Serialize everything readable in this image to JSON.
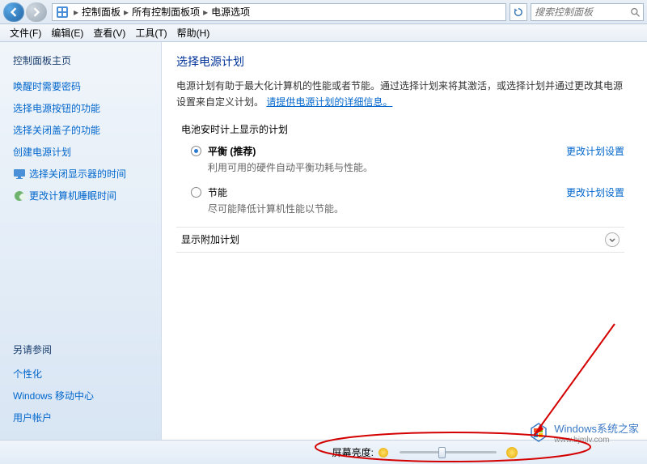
{
  "nav": {
    "breadcrumb": {
      "root_icon": "control-panel-icon",
      "parts": [
        "控制面板",
        "所有控制面板项",
        "电源选项"
      ]
    },
    "search_placeholder": "搜索控制面板"
  },
  "menu": {
    "items": [
      {
        "label": "文件(F)"
      },
      {
        "label": "编辑(E)"
      },
      {
        "label": "查看(V)"
      },
      {
        "label": "工具(T)"
      },
      {
        "label": "帮助(H)"
      }
    ]
  },
  "sidebar": {
    "home": "控制面板主页",
    "links": [
      {
        "label": "唤醒时需要密码",
        "icon": null
      },
      {
        "label": "选择电源按钮的功能",
        "icon": null
      },
      {
        "label": "选择关闭盖子的功能",
        "icon": null
      },
      {
        "label": "创建电源计划",
        "icon": null
      },
      {
        "label": "选择关闭显示器的时间",
        "icon": "monitor-icon"
      },
      {
        "label": "更改计算机睡眠时间",
        "icon": "sleep-icon"
      }
    ],
    "see_also_title": "另请参阅",
    "see_also": [
      "个性化",
      "Windows 移动中心",
      "用户帐户"
    ]
  },
  "main": {
    "title": "选择电源计划",
    "desc_before": "电源计划有助于最大化计算机的性能或者节能。通过选择计划来将其激活，或选择计划并通过更改其电源设置来自定义计划。",
    "desc_link": "请提供电源计划的详细信息。",
    "section_header": "电池安时计上显示的计划",
    "plans": [
      {
        "name": "平衡 (推荐)",
        "desc": "利用可用的硬件自动平衡功耗与性能。",
        "selected": true,
        "action": "更改计划设置"
      },
      {
        "name": "节能",
        "desc": "尽可能降低计算机性能以节能。",
        "selected": false,
        "action": "更改计划设置"
      }
    ],
    "show_more": "显示附加计划"
  },
  "bottom": {
    "brightness_label": "屏幕亮度:",
    "slider_value": 40
  },
  "watermark": {
    "line1": "Windows系统之家",
    "line2": "www.bjmlv.com"
  }
}
